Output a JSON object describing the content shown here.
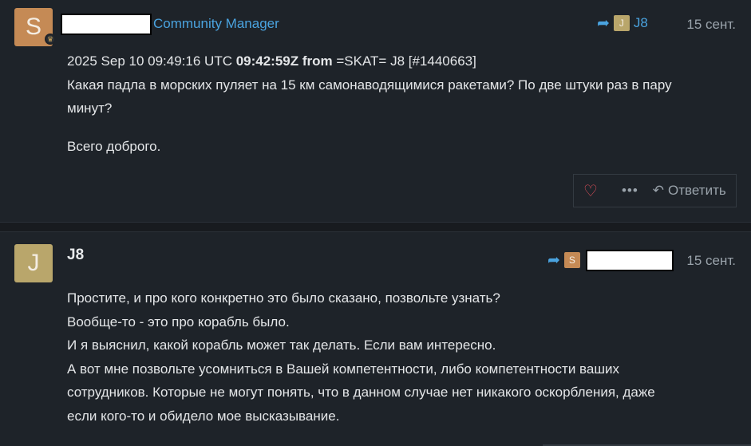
{
  "post1": {
    "avatar_letter": "S",
    "author_role": "Community Manager",
    "reply_to_letter": "J",
    "reply_to_name": "J8",
    "date": "15 сент.",
    "header_line_plain": "2025 Sep 10 09:49:16 UTC ",
    "header_line_bold": "09:42:59Z from",
    "header_line_rest": " =SKAT= J8 [#1440663]",
    "text_line1": "Какая падла в морских пуляет на 15 км самонаводящимися ракетами? По две штуки раз в пару",
    "text_line2": "минут?",
    "signoff": "Всего доброго.",
    "actions": {
      "more": "•••",
      "reply": "Ответить"
    }
  },
  "post2": {
    "avatar_letter": "J",
    "author": "J8",
    "reply_to_letter": "S",
    "date": "15 сент.",
    "lines": [
      "Простите, и про кого конкретно это было сказано, позвольте узнать?",
      "Вообще-то - это про корабль было.",
      "И я выяснил, какой корабль может так делать. Если вам интересно.",
      "А вот мне позвольте усомниться в Вашей компетентности, либо компетентности ваших",
      "сотрудников. Которые не могут понять, что в данном случае нет никакого оскорбления, даже",
      "если кого-то и обидело мое высказывание."
    ]
  },
  "icons": {
    "badge": "shield-badge-icon",
    "reply_arrow": "share-arrow-icon",
    "like": "heart-icon",
    "more": "ellipsis-icon",
    "reply": "reply-icon"
  },
  "colors": {
    "background": "#1e2329",
    "separator": "#181b1f",
    "link": "#4aa3df",
    "heart": "#e0505a",
    "avatar_s": "#c58a55",
    "avatar_j": "#b9a66b"
  }
}
